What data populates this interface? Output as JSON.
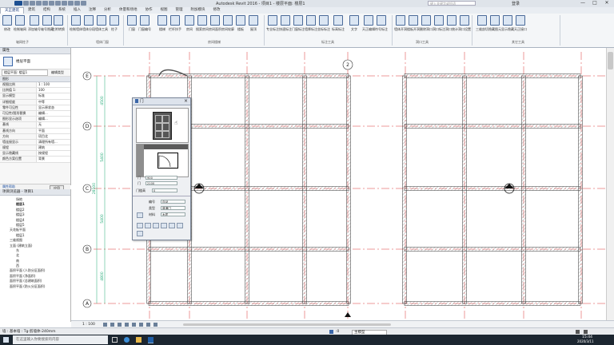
{
  "app": {
    "title": "Autodesk Revit 2016 -   项目1 - 楼层平面: 楼层1",
    "search_placeholder": "键入关键字或短语",
    "user": "登录",
    "min_label": "—",
    "max_label": "□",
    "close_label": "✕"
  },
  "menu": {
    "tabs": [
      "天正建筑",
      "建筑",
      "结构",
      "系统",
      "插入",
      "注释",
      "分析",
      "体量和场地",
      "协作",
      "视图",
      "管理",
      "附加模块",
      "修改"
    ],
    "active_index": 0
  },
  "ribbon": {
    "tools": [
      {
        "label": "修改"
      },
      {
        "label": "绘制轴网"
      },
      {
        "label": "添加轴号"
      },
      {
        "label": "轴号隐藏"
      },
      {
        "label": "主附转换"
      },
      {
        "label": "绘制墙体"
      },
      {
        "label": "墙体分段"
      },
      {
        "label": "墙体工具"
      },
      {
        "label": "柱子"
      },
      {
        "label": "门窗"
      },
      {
        "label": "门窗编号"
      },
      {
        "label": "楼梯"
      },
      {
        "label": "栏杆扶手"
      },
      {
        "label": "房间"
      },
      {
        "label": "搜索房间"
      },
      {
        "label": "房间面积"
      },
      {
        "label": "房间轮廓"
      },
      {
        "label": "楼板"
      },
      {
        "label": "屋顶"
      },
      {
        "label": "专业标注"
      },
      {
        "label": "快速标注"
      },
      {
        "label": "门窗标注"
      },
      {
        "label": "墙厚标注"
      },
      {
        "label": "坐标标注"
      },
      {
        "label": "标高标注"
      },
      {
        "label": "文字"
      },
      {
        "label": "天正编辑"
      },
      {
        "label": "符号标注"
      },
      {
        "label": "墙体开洞"
      },
      {
        "label": "楼板开洞"
      },
      {
        "label": "删除洞口"
      },
      {
        "label": "洞口标注"
      },
      {
        "label": "洞口统计"
      },
      {
        "label": "洞口设置"
      },
      {
        "label": "三维剖切"
      },
      {
        "label": "隐藏图元"
      },
      {
        "label": "显示隐藏"
      },
      {
        "label": "天正接口"
      }
    ],
    "panels": [
      "轴网柱子",
      "墙体门窗",
      "房间楼梯",
      "标注工具",
      "",
      "洞口工具",
      "其它工具"
    ]
  },
  "properties": {
    "header": "属性",
    "type_name": "楼层平面",
    "view_select": "楼层平面: 楼层1",
    "edit_type": "编辑类型",
    "section": "图形",
    "rows": [
      {
        "k": "视图比例",
        "v": "1 : 100"
      },
      {
        "k": "比例值 1:",
        "v": "100"
      },
      {
        "k": "显示模型",
        "v": "标准"
      },
      {
        "k": "详细程度",
        "v": "中等"
      },
      {
        "k": "零件可见性",
        "v": "显示原状态"
      },
      {
        "k": "可见性/图形替换",
        "v": "编辑..."
      },
      {
        "k": "图形显示选项",
        "v": "编辑..."
      },
      {
        "k": "基线",
        "v": "无"
      },
      {
        "k": "基线方向",
        "v": "平面"
      },
      {
        "k": "方向",
        "v": "项目北"
      },
      {
        "k": "墙连接显示",
        "v": "清理所有墙..."
      },
      {
        "k": "规程",
        "v": "建筑"
      },
      {
        "k": "显示隐藏线",
        "v": "按规程"
      },
      {
        "k": "颜色方案位置",
        "v": "背景"
      }
    ],
    "help_link": "属性帮助",
    "apply": "应用"
  },
  "browser": {
    "header": "项目浏览器 - 项目1",
    "items": [
      "场地",
      "楼层1",
      "楼层2",
      "楼层3",
      "楼层4",
      "楼层5",
      "天花板平面",
      "楼层1",
      "三维视图",
      "立面 (建筑立面)",
      "东",
      "北",
      "南",
      "西",
      "面积平面 (人防分区面积)",
      "面积平面 (净面积)",
      "面积平面 (总建筑面积)",
      "面积平面 (防火分区面积)"
    ],
    "indents": [
      2,
      2,
      2,
      2,
      2,
      2,
      1,
      2,
      1,
      1,
      2,
      2,
      2,
      2,
      1,
      1,
      1,
      1
    ]
  },
  "grid": {
    "rows": [
      "E",
      "D",
      "C",
      "B",
      "A"
    ],
    "top_axis": "2",
    "dims": [
      "4500",
      "5400",
      "28100",
      "5400",
      "4800"
    ]
  },
  "door_dialog": {
    "title": "门",
    "f1_label": "门",
    "f1_value": "900",
    "f2_label": "门",
    "f2_value": "2100",
    "f3_label": "门槛高",
    "f3_value": "0",
    "code_label": "编号",
    "code_value": "自动",
    "type_label": "类型",
    "type_value": "普通门",
    "mat_label": "材料",
    "mat_value": "木质"
  },
  "viewbar": {
    "scale": "1 : 100"
  },
  "status": {
    "text": "墙 : 基本墙 : Tg-剪墙体-240mm",
    "zero": ":0",
    "model": "主模型"
  },
  "taskbar": {
    "search": "在这里输入你要搜索的内容",
    "time": "15:44",
    "date": "2020/3/11"
  }
}
